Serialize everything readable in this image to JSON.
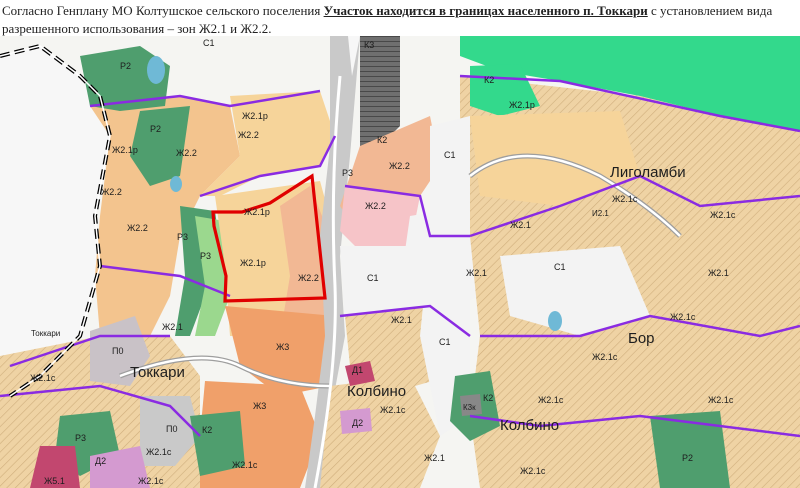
{
  "caption": {
    "text1": "Согласно Генплану МО Колтушское сельского поселения ",
    "bold": "Участок находится в границах населенного п. Токкари",
    "text2": " с установлением вида разрешенного использования – зон Ж2.1 и Ж2.2."
  },
  "map": {
    "colors": {
      "residential": "#f4d8a0",
      "residential_dense": "#f2b894",
      "recreation": "#4fa06e",
      "green": "#8fcf9a",
      "forest_bright": "#33d98c",
      "agri": "#f3f3f3",
      "boundary": "#8a2be2",
      "road": "#a9a9a9",
      "plot": "#e00000",
      "water": "#6fb9d6",
      "industrial": "#d37b54"
    },
    "settlements": {
      "ligolambi": "Лиголамби",
      "bor": "Бор",
      "tokkari": "Токкари",
      "kolbino1": "Колбино",
      "kolbino2": "Колбино"
    },
    "zones": {
      "c1_top": "С1",
      "p2_a": "Р2",
      "p2_b": "Р2",
      "zh21p_a": "Ж2.1р",
      "zh22_a": "Ж2.2",
      "zh21p_b": "Ж2.1р",
      "zh22_b": "Ж2.2",
      "zh22_c": "Ж2.2",
      "p3_a": "Р3",
      "p3_b": "Р3",
      "zh21p_c": "Ж2.1р",
      "zh21p_d": "Ж2.1р",
      "zh22_plot": "Ж2.2",
      "zh21_a": "Ж2.1",
      "p0_a": "П0",
      "tokkari_small": "Токкари",
      "zh21s_a": "Ж2.1с",
      "zh3_a": "Ж3",
      "zh3_b": "Ж3",
      "k3": "К3",
      "k2_a": "К2",
      "k2_b": "К2",
      "p3_c": "Р3",
      "zh22_d": "Ж2.2",
      "zh22_e": "Ж2.2",
      "c1_a": "С1",
      "c1_b": "С1",
      "c1_c": "С1",
      "c1_d": "С1",
      "zh21_b": "Ж2.1",
      "zh21_c": "Ж2.1",
      "zh21_d": "Ж2.1",
      "zh21p_e": "Ж2.1р",
      "zh21s_b": "Ж2.1с",
      "zh21s_c": "Ж2.1с",
      "zh21s_d": "Ж2.1с",
      "zh21s_e": "Ж2.1с",
      "zh21s_f": "Ж2.1с",
      "zh21s_g": "Ж2.1с",
      "zh21s_h": "Ж2.1с",
      "zh21s_i": "Ж2.1с",
      "zh21_e": "Ж2.1",
      "zh21_f": "Ж2.1",
      "i2": "И2.1",
      "d1": "Д1",
      "d2_a": "Д2",
      "d2_b": "Д2",
      "k3s": "К3к",
      "k2_c": "К2",
      "k2_d": "К2",
      "p2_c": "Р2",
      "p3_d": "Р3",
      "p0_b": "П0",
      "zh51": "Ж5.1",
      "zh21s_j": "Ж2.1с",
      "zh21s_k": "Ж2.1с",
      "zh21s_l": "Ж2.1с"
    }
  }
}
